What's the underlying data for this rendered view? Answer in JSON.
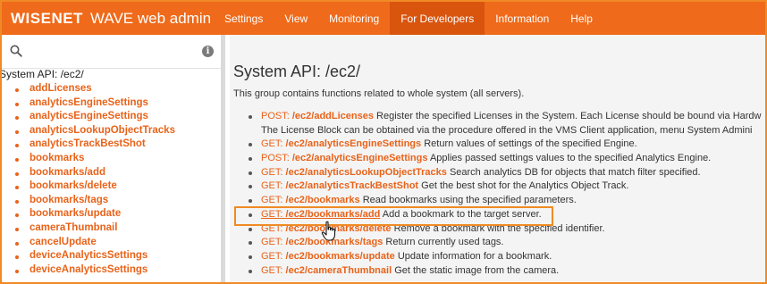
{
  "header": {
    "brand_logo": "WISENET",
    "brand_title": "WAVE web admin",
    "nav": [
      {
        "label": "Settings",
        "active": false
      },
      {
        "label": "View",
        "active": false
      },
      {
        "label": "Monitoring",
        "active": false
      },
      {
        "label": "For Developers",
        "active": true
      },
      {
        "label": "Information",
        "active": false
      },
      {
        "label": "Help",
        "active": false
      }
    ]
  },
  "sidebar": {
    "search_placeholder": "",
    "heading": "System API: /ec2/",
    "items": [
      "addLicenses",
      "analyticsEngineSettings",
      "analyticsEngineSettings",
      "analyticsLookupObjectTracks",
      "analyticsTrackBestShot",
      "bookmarks",
      "bookmarks/add",
      "bookmarks/delete",
      "bookmarks/tags",
      "bookmarks/update",
      "cameraThumbnail",
      "cancelUpdate",
      "deviceAnalyticsSettings",
      "deviceAnalyticsSettings"
    ]
  },
  "main": {
    "title": "System API: /ec2/",
    "description": "This group contains functions related to whole system (all servers).",
    "functions": [
      {
        "method": "POST:",
        "path": "/ec2/addLicenses",
        "desc": "Register the specified Licenses in the System. Each License should be bound via Hardw",
        "continuation": "The License Block can be obtained via the procedure offered in the VMS Client application, menu System Admini"
      },
      {
        "method": "GET:",
        "path": "/ec2/analyticsEngineSettings",
        "desc": "Return values of settings of the specified Engine."
      },
      {
        "method": "POST:",
        "path": "/ec2/analyticsEngineSettings",
        "desc": "Applies passed settings values to the specified Analytics Engine."
      },
      {
        "method": "GET:",
        "path": "/ec2/analyticsLookupObjectTracks",
        "desc": "Search analytics DB for objects that match filter specified."
      },
      {
        "method": "GET:",
        "path": "/ec2/analyticsTrackBestShot",
        "desc": "Get the best shot for the Analytics Object Track."
      },
      {
        "method": "GET:",
        "path": "/ec2/bookmarks",
        "desc": "Read bookmarks using the specified parameters."
      },
      {
        "method": "GET:",
        "path": "/ec2/bookmarks/add",
        "desc": "Add a bookmark to the target server."
      },
      {
        "method": "GET:",
        "path": "/ec2/bookmarks/delete",
        "desc": "Remove a bookmark with the specified identifier."
      },
      {
        "method": "GET:",
        "path": "/ec2/bookmarks/tags",
        "desc": "Return currently used tags."
      },
      {
        "method": "GET:",
        "path": "/ec2/bookmarks/update",
        "desc": "Update information for a bookmark."
      },
      {
        "method": "GET:",
        "path": "/ec2/cameraThumbnail",
        "desc": "Get the static image from the camera."
      }
    ]
  },
  "colors": {
    "accent": "#ef6a1a",
    "accent_active": "#d9550e",
    "link": "#e8631a",
    "highlight_box": "#f08a24"
  },
  "icons": {
    "search": "search-icon",
    "info": "info-icon",
    "cursor": "hand-pointer-icon"
  }
}
